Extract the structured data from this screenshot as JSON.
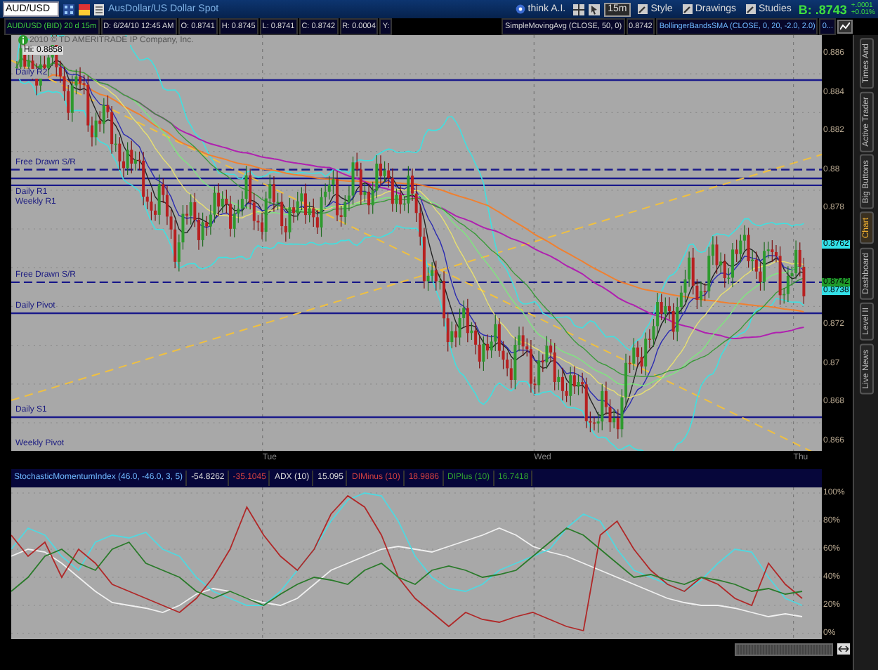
{
  "symbol": {
    "value": "AUD/USD",
    "description": "AusDollar/US Dollar Spot"
  },
  "toolbar": {
    "think_button": "think A.I.",
    "timeframe": "15m",
    "buttons": [
      "Style",
      "Drawings",
      "Studies"
    ]
  },
  "quote": {
    "bid": "B: .8743",
    "change": "+.0001",
    "change_percent": "+0.01%"
  },
  "readouts": [
    {
      "text": "AUD/USD (BID) 20 d 15m",
      "kind": "symbol"
    },
    {
      "text": "D: 6/24/10 12:45 AM",
      "kind": "value"
    },
    {
      "text": "O: 0.8741",
      "kind": "value"
    },
    {
      "text": "H: 0.8745",
      "kind": "value"
    },
    {
      "text": "L: 0.8741",
      "kind": "value"
    },
    {
      "text": "C: 0.8742",
      "kind": "value"
    },
    {
      "text": "R: 0.0004",
      "kind": "value"
    },
    {
      "text": "Y:",
      "kind": "value"
    }
  ],
  "studies": [
    {
      "text": "SimpleMovingAvg (CLOSE, 50, 0)",
      "kind": "value"
    },
    {
      "text": "0.8742",
      "kind": "value"
    },
    {
      "text": "BollingerBandsSMA (CLOSE, 0, 20, -2.0, 2.0)",
      "kind": "study"
    },
    {
      "text": "0...",
      "kind": "study"
    }
  ],
  "chart": {
    "copyright": "2010 © TD AMERITRADE IP Company, Inc.",
    "high_label": "Hi: 0.8858",
    "levels": [
      "Daily R2",
      "Free Drawn S/R",
      "Daily R1",
      "Weekly R1",
      "Free Drawn S/R",
      "Daily Pivot",
      "Daily S1",
      "Weekly Pivot"
    ],
    "price_ticks": [
      "0.886",
      "0.884",
      "0.882",
      "0.88",
      "0.878",
      "0.872",
      "0.87",
      "0.868",
      "0.866"
    ],
    "price_tags": [
      {
        "text": "0.8762",
        "color": "#33e0e8"
      },
      {
        "text": "0.8742",
        "color": "#1f9a2a"
      },
      {
        "text": "0.8738",
        "color": "#33e0e8"
      }
    ],
    "time_labels": [
      "Tue",
      "Wed",
      "Thu"
    ]
  },
  "lower": {
    "legend": [
      {
        "text": "StochasticMomentumIndex (46.0, -46.0, 3, 5)",
        "kind": "study"
      },
      {
        "text": "-54.8262",
        "kind": "value"
      },
      {
        "text": "-35.1045",
        "kind": "minus"
      },
      {
        "text": "ADX (10)",
        "kind": "value"
      },
      {
        "text": "15.095",
        "kind": "value"
      },
      {
        "text": "DIMinus (10)",
        "kind": "minus"
      },
      {
        "text": "18.9886",
        "kind": "minus"
      },
      {
        "text": "DIPlus (10)",
        "kind": "plus"
      },
      {
        "text": "16.7418",
        "kind": "plus"
      }
    ],
    "chart_data": {
      "type": "line",
      "grid": true,
      "ylim": [
        0,
        100
      ],
      "yticks": [
        {
          "value": 100,
          "label": "100%"
        },
        {
          "value": 80,
          "label": "80%"
        },
        {
          "value": 60,
          "label": "60%"
        },
        {
          "value": 40,
          "label": "40%"
        },
        {
          "value": 20,
          "label": "20%"
        },
        {
          "value": 0,
          "label": "0%"
        }
      ],
      "series": [
        {
          "color": "#f0f0f0",
          "values": [
            55,
            60,
            58,
            50,
            40,
            30,
            22,
            20,
            18,
            15,
            20,
            28,
            32,
            30,
            25,
            22,
            20,
            25,
            35,
            45,
            50,
            55,
            60,
            62,
            60,
            58,
            62,
            66,
            70,
            75,
            70,
            62,
            58,
            55,
            50,
            45,
            40,
            35,
            30,
            25,
            22,
            20,
            20,
            18,
            15,
            12,
            14,
            12
          ]
        },
        {
          "color": "#50d8e0",
          "values": [
            60,
            75,
            70,
            55,
            45,
            65,
            70,
            68,
            72,
            60,
            55,
            40,
            30,
            25,
            20,
            20,
            30,
            45,
            60,
            80,
            95,
            100,
            98,
            80,
            55,
            40,
            32,
            30,
            35,
            45,
            50,
            55,
            60,
            75,
            85,
            80,
            60,
            45,
            40,
            35,
            30,
            38,
            50,
            60,
            58,
            40,
            25,
            20
          ]
        },
        {
          "color": "#b02828",
          "values": [
            70,
            55,
            65,
            40,
            60,
            50,
            35,
            30,
            25,
            20,
            15,
            25,
            40,
            60,
            90,
            70,
            55,
            45,
            60,
            85,
            98,
            90,
            70,
            40,
            25,
            15,
            5,
            15,
            10,
            8,
            12,
            15,
            10,
            5,
            2,
            70,
            80,
            60,
            45,
            35,
            30,
            40,
            35,
            25,
            20,
            50,
            35,
            25
          ]
        },
        {
          "color": "#2a7a2a",
          "values": [
            30,
            40,
            55,
            60,
            50,
            45,
            60,
            65,
            50,
            45,
            40,
            30,
            25,
            30,
            25,
            20,
            28,
            35,
            40,
            38,
            35,
            45,
            50,
            40,
            35,
            45,
            48,
            45,
            40,
            42,
            45,
            55,
            65,
            75,
            70,
            60,
            50,
            40,
            42,
            38,
            35,
            40,
            38,
            35,
            30,
            32,
            28,
            30
          ]
        }
      ]
    }
  },
  "side_tabs": [
    {
      "label": "Times And",
      "selected": false
    },
    {
      "label": "Active Trader",
      "selected": false
    },
    {
      "label": "Big Buttons",
      "selected": false
    },
    {
      "label": "Chart",
      "selected": true
    },
    {
      "label": "Dashboard",
      "selected": false
    },
    {
      "label": "Level II",
      "selected": false
    },
    {
      "label": "Live News",
      "selected": false
    }
  ]
}
